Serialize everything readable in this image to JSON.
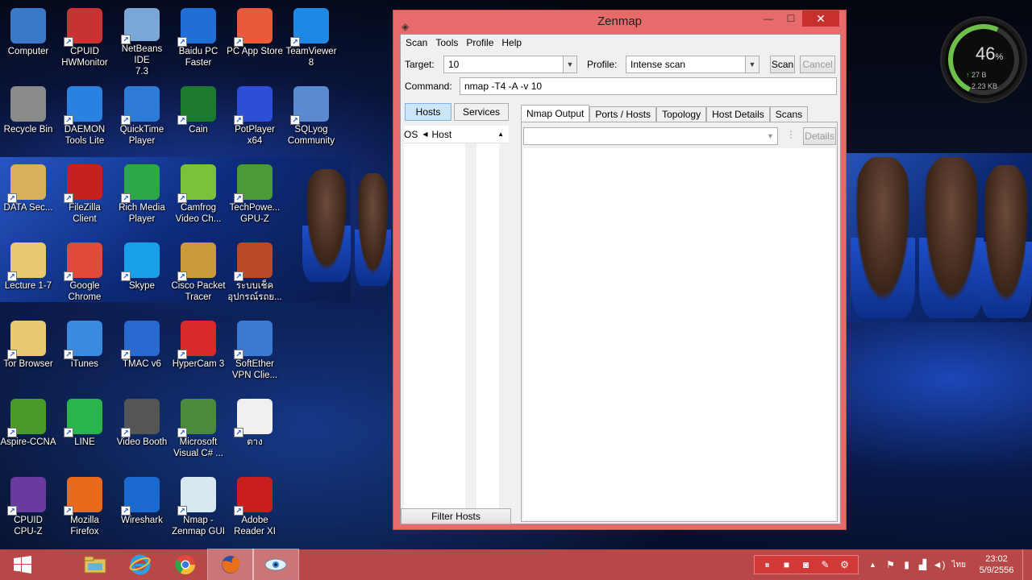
{
  "desktop": {
    "icons": [
      {
        "label": "Computer",
        "icon": "computer-icon",
        "color": "#3a78c8"
      },
      {
        "label": "CPUID\nHWMonitor",
        "icon": "hwmonitor-icon",
        "color": "#c83232"
      },
      {
        "label": "NetBeans IDE\n7.3",
        "icon": "netbeans-icon",
        "color": "#7aa6d8"
      },
      {
        "label": "Baidu PC\nFaster",
        "icon": "baidu-icon",
        "color": "#1f6fd6"
      },
      {
        "label": "PC App Store",
        "icon": "app-store-icon",
        "color": "#e85a3a"
      },
      {
        "label": "TeamViewer\n8",
        "icon": "teamviewer-icon",
        "color": "#1e88e5"
      },
      {
        "label": "Recycle Bin",
        "icon": "recycle-bin-icon",
        "color": "#8a8a8a"
      },
      {
        "label": "DAEMON\nTools Lite",
        "icon": "daemon-tools-icon",
        "color": "#2a82e0"
      },
      {
        "label": "QuickTime\nPlayer",
        "icon": "quicktime-icon",
        "color": "#2d7bd6"
      },
      {
        "label": "Cain",
        "icon": "cain-icon",
        "color": "#1b7a2b"
      },
      {
        "label": "PotPlayer x64",
        "icon": "potplayer-icon",
        "color": "#2d4fd6"
      },
      {
        "label": "SQLyog\nCommunity",
        "icon": "sqlyog-icon",
        "color": "#5a8ad0"
      },
      {
        "label": "DATA Sec...",
        "icon": "pdf-file-icon",
        "color": "#d8b05a"
      },
      {
        "label": "FileZilla\nClient",
        "icon": "filezilla-icon",
        "color": "#c8201e"
      },
      {
        "label": "Rich Media\nPlayer",
        "icon": "rich-media-icon",
        "color": "#2aa84a"
      },
      {
        "label": "Camfrog\nVideo Ch...",
        "icon": "camfrog-icon",
        "color": "#7ac23a"
      },
      {
        "label": "TechPowe...\nGPU-Z",
        "icon": "gpuz-icon",
        "color": "#4a9a3a"
      },
      {
        "label": "Lecture 1-7",
        "icon": "folder-icon",
        "color": "#e8c870"
      },
      {
        "label": "Google\nChrome",
        "icon": "chrome-icon",
        "color": "#e04a3a"
      },
      {
        "label": "Skype",
        "icon": "skype-icon",
        "color": "#1aa0e8"
      },
      {
        "label": "Cisco Packet\nTracer",
        "icon": "packet-tracer-icon",
        "color": "#c89a3a"
      },
      {
        "label": "ระบบเช็ค\nอุปกรณ์รถย...",
        "icon": "pptx-file-icon",
        "color": "#b84a2a"
      },
      {
        "label": "Tor Browser",
        "icon": "folder-icon",
        "color": "#e8c870"
      },
      {
        "label": "iTunes",
        "icon": "itunes-icon",
        "color": "#3a8ae0"
      },
      {
        "label": "TMAC v6",
        "icon": "tmac-icon",
        "color": "#2a6ad0"
      },
      {
        "label": "HyperCam 3",
        "icon": "hypercam-icon",
        "color": "#d82a2a"
      },
      {
        "label": "SoftEther\nVPN Clie...",
        "icon": "softether-icon",
        "color": "#3a7ad0"
      },
      {
        "label": "Aspire-CCNA",
        "icon": "aspire-icon",
        "color": "#4a9a2a"
      },
      {
        "label": "LINE",
        "icon": "line-icon",
        "color": "#2ab54a"
      },
      {
        "label": "Video Booth",
        "icon": "video-booth-icon",
        "color": "#555555"
      },
      {
        "label": "Microsoft\nVisual C# ...",
        "icon": "visual-csharp-icon",
        "color": "#4a8a3a"
      },
      {
        "label": "ตาง",
        "icon": "text-file-icon",
        "color": "#f0f0f0"
      },
      {
        "label": "CPUID\nCPU-Z",
        "icon": "cpuz-icon",
        "color": "#6a3aa0"
      },
      {
        "label": "Mozilla\nFirefox",
        "icon": "firefox-icon",
        "color": "#e86a1a"
      },
      {
        "label": "Wireshark",
        "icon": "wireshark-icon",
        "color": "#1a6ad0"
      },
      {
        "label": "Nmap -\nZenmap GUI",
        "icon": "zenmap-icon",
        "color": "#d8e8f0"
      },
      {
        "label": "Adobe\nReader XI",
        "icon": "adobe-reader-icon",
        "color": "#c81e1e"
      }
    ]
  },
  "gauge": {
    "percent": "46",
    "percent_unit": "%",
    "upload": "27 B",
    "download": "2.23 KB",
    "accent": "#6ec04a"
  },
  "window": {
    "title": "Zenmap",
    "frame_color": "#e86a6a",
    "menu": [
      "Scan",
      "Tools",
      "Profile",
      "Help"
    ],
    "target_label": "Target:",
    "target_value": "10",
    "profile_label": "Profile:",
    "profile_value": "Intense scan",
    "scan_button": "Scan",
    "cancel_button": "Cancel",
    "command_label": "Command:",
    "command_value": "nmap -T4 -A -v 10",
    "left_tabs": [
      "Hosts",
      "Services"
    ],
    "host_columns": [
      "OS",
      "Host"
    ],
    "filter_button": "Filter Hosts",
    "right_tabs": [
      "Nmap Output",
      "Ports / Hosts",
      "Topology",
      "Host Details",
      "Scans"
    ],
    "details_button": "Details"
  },
  "taskbar": {
    "color": "#b84848",
    "apps": [
      {
        "icon": "windows-start-icon"
      },
      {
        "icon": "file-explorer-icon"
      },
      {
        "icon": "internet-explorer-icon"
      },
      {
        "icon": "chrome-icon"
      },
      {
        "icon": "firefox-icon"
      },
      {
        "icon": "zenmap-icon",
        "active": true
      }
    ],
    "tray": {
      "language": "ไทย",
      "time": "23:02",
      "date": "5/9/2556"
    }
  }
}
